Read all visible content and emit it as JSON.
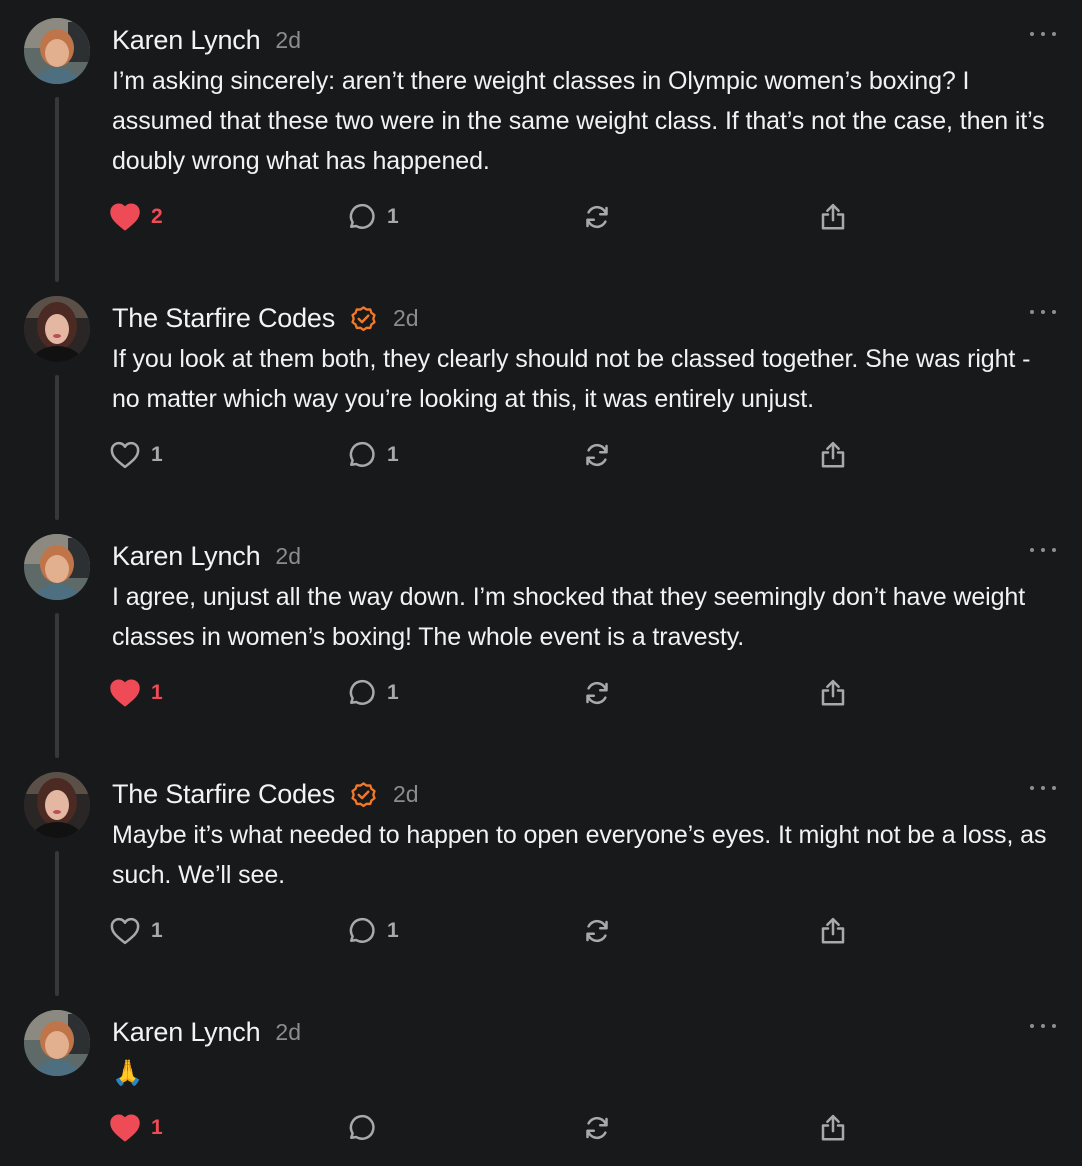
{
  "colors": {
    "background": "#18191b",
    "text": "#f2f2f2",
    "muted": "#8b8c8e",
    "like_active": "#ef4b57",
    "verified": "#f07a2c",
    "thread_line": "#36383b"
  },
  "posts": [
    {
      "author": "Karen Lynch",
      "verified": false,
      "time": "2d",
      "text": "I’m asking sincerely: aren’t there weight classes in Olympic women’s boxing? I assumed that these two were in the same weight class. If that’s not the case, then it’s doubly wrong what has happened.",
      "liked": true,
      "likes": "2",
      "replies": "1",
      "avatar_icon": "karen-avatar"
    },
    {
      "author": "The Starfire Codes",
      "verified": true,
      "time": "2d",
      "text": "If you look at them both, they clearly should not be classed together. She was right - no matter which way you’re looking at this, it was entirely unjust.",
      "liked": false,
      "likes": "1",
      "replies": "1",
      "avatar_icon": "starfire-avatar"
    },
    {
      "author": "Karen Lynch",
      "verified": false,
      "time": "2d",
      "text": "I agree, unjust all the way down. I’m shocked that they seemingly don’t have weight classes in women’s boxing! The whole event is a travesty.",
      "liked": true,
      "likes": "1",
      "replies": "1",
      "avatar_icon": "karen-avatar"
    },
    {
      "author": "The Starfire Codes",
      "verified": true,
      "time": "2d",
      "text": "Maybe it’s what needed to happen to open everyone’s eyes. It might not be a loss, as such. We’ll see.",
      "liked": false,
      "likes": "1",
      "replies": "1",
      "avatar_icon": "starfire-avatar"
    },
    {
      "author": "Karen Lynch",
      "verified": false,
      "time": "2d",
      "text": "🙏",
      "liked": true,
      "likes": "1",
      "replies": "",
      "avatar_icon": "karen-avatar"
    }
  ],
  "icons": {
    "like": "heart-icon",
    "reply": "speech-bubble-icon",
    "repost": "repost-icon",
    "share": "share-icon",
    "more": "more-options-icon",
    "verified": "verified-badge-icon"
  }
}
